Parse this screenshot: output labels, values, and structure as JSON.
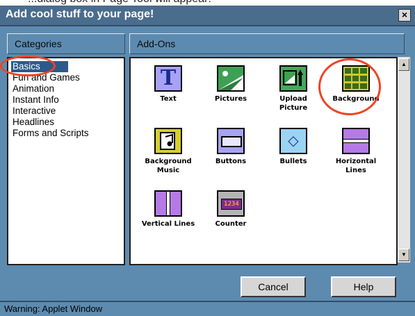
{
  "window": {
    "title": "Add cool stuff to your page!",
    "close_label": "×"
  },
  "categories": {
    "header": "Categories",
    "items": [
      "Basics",
      "Fun and Games",
      "Animation",
      "Instant Info",
      "Interactive",
      "Headlines",
      "Forms and Scripts"
    ],
    "selected": "Basics"
  },
  "addons": {
    "header": "Add-Ons",
    "items": [
      {
        "label": "Text",
        "icon": "text-T-icon"
      },
      {
        "label": "Pictures",
        "icon": "picture-icon"
      },
      {
        "label": "Upload Picture",
        "icon": "upload-picture-icon"
      },
      {
        "label": "Background",
        "icon": "background-grid-icon"
      },
      {
        "label": "Background Music",
        "icon": "music-note-icon"
      },
      {
        "label": "Buttons",
        "icon": "button-icon"
      },
      {
        "label": "Bullets",
        "icon": "bullet-diamond-icon"
      },
      {
        "label": "Horizontal Lines",
        "icon": "horizontal-line-icon"
      },
      {
        "label": "Vertical Lines",
        "icon": "vertical-line-icon"
      },
      {
        "label": "Counter",
        "icon": "counter-icon"
      }
    ],
    "counter_display": "1234"
  },
  "buttons": {
    "cancel": "Cancel",
    "help": "Help"
  },
  "status": "Warning: Applet Window",
  "colors": {
    "window_bg": "#5d8bb0",
    "title_bg": "#4a6d8e",
    "selection": "#2c5a8a",
    "highlight_circle": "#ee4424"
  }
}
